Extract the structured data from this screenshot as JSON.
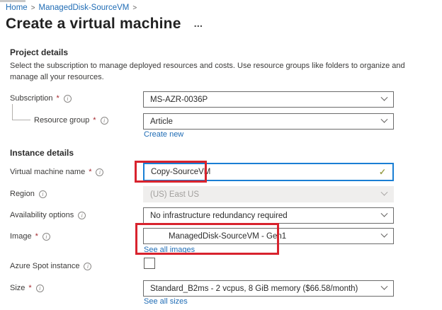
{
  "breadcrumb": {
    "home": "Home",
    "separator": ">",
    "parent": "ManagedDisk-SourceVM"
  },
  "header": {
    "title": "Create a virtual machine",
    "more_label": "..."
  },
  "sections": {
    "project": {
      "heading": "Project details",
      "description": "Select the subscription to manage deployed resources and costs. Use resource groups like folders to organize and manage all your resources."
    },
    "instance": {
      "heading": "Instance details"
    }
  },
  "fields": {
    "subscription": {
      "label": "Subscription",
      "required_mark": "*",
      "value": "MS-AZR-0036P"
    },
    "resource_group": {
      "label": "Resource group",
      "required_mark": "*",
      "value": "Article",
      "create_new": "Create new"
    },
    "vm_name": {
      "label": "Virtual machine name",
      "required_mark": "*",
      "value": "Copy-SourceVM",
      "valid_mark": "✓"
    },
    "region": {
      "label": "Region",
      "value": "(US) East US"
    },
    "availability": {
      "label": "Availability options",
      "value": "No infrastructure redundancy required"
    },
    "image": {
      "label": "Image",
      "required_mark": "*",
      "value": "ManagedDisk-SourceVM - Gen1",
      "see_all": "See all images"
    },
    "spot": {
      "label": "Azure Spot instance"
    },
    "size": {
      "label": "Size",
      "required_mark": "*",
      "value": "Standard_B2ms - 2 vcpus, 8 GiB memory ($66.58/month)",
      "see_all": "See all sizes"
    }
  },
  "icons": {
    "info": "i"
  },
  "colors": {
    "link_blue": "#1f6cb5",
    "required_red": "#a4262c",
    "focus_border_blue": "#1a7fd4",
    "highlight_box_red": "#d8232e",
    "valid_check_green": "#9aa04c",
    "disabled_bg": "#efeeed"
  }
}
